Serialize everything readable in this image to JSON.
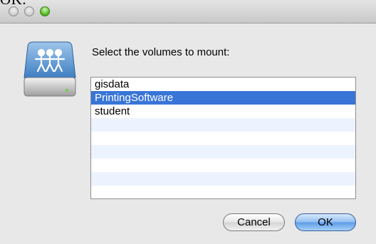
{
  "caption": "OK.",
  "dialog": {
    "prompt": "Select the volumes to mount:",
    "volumes": [
      {
        "label": "gisdata"
      },
      {
        "label": "PrintingSoftware"
      },
      {
        "label": "student"
      },
      {
        "label": ""
      },
      {
        "label": ""
      },
      {
        "label": ""
      },
      {
        "label": ""
      },
      {
        "label": ""
      },
      {
        "label": ""
      }
    ],
    "selected_volume": "PrintingSoftware",
    "cancel_label": "Cancel",
    "ok_label": "OK"
  },
  "icons": {
    "drive": "network-drive-icon"
  },
  "colors": {
    "selection": "#3875d7",
    "alternate_row": "#edf3fe",
    "zoom_button": "#5cbf2a"
  }
}
